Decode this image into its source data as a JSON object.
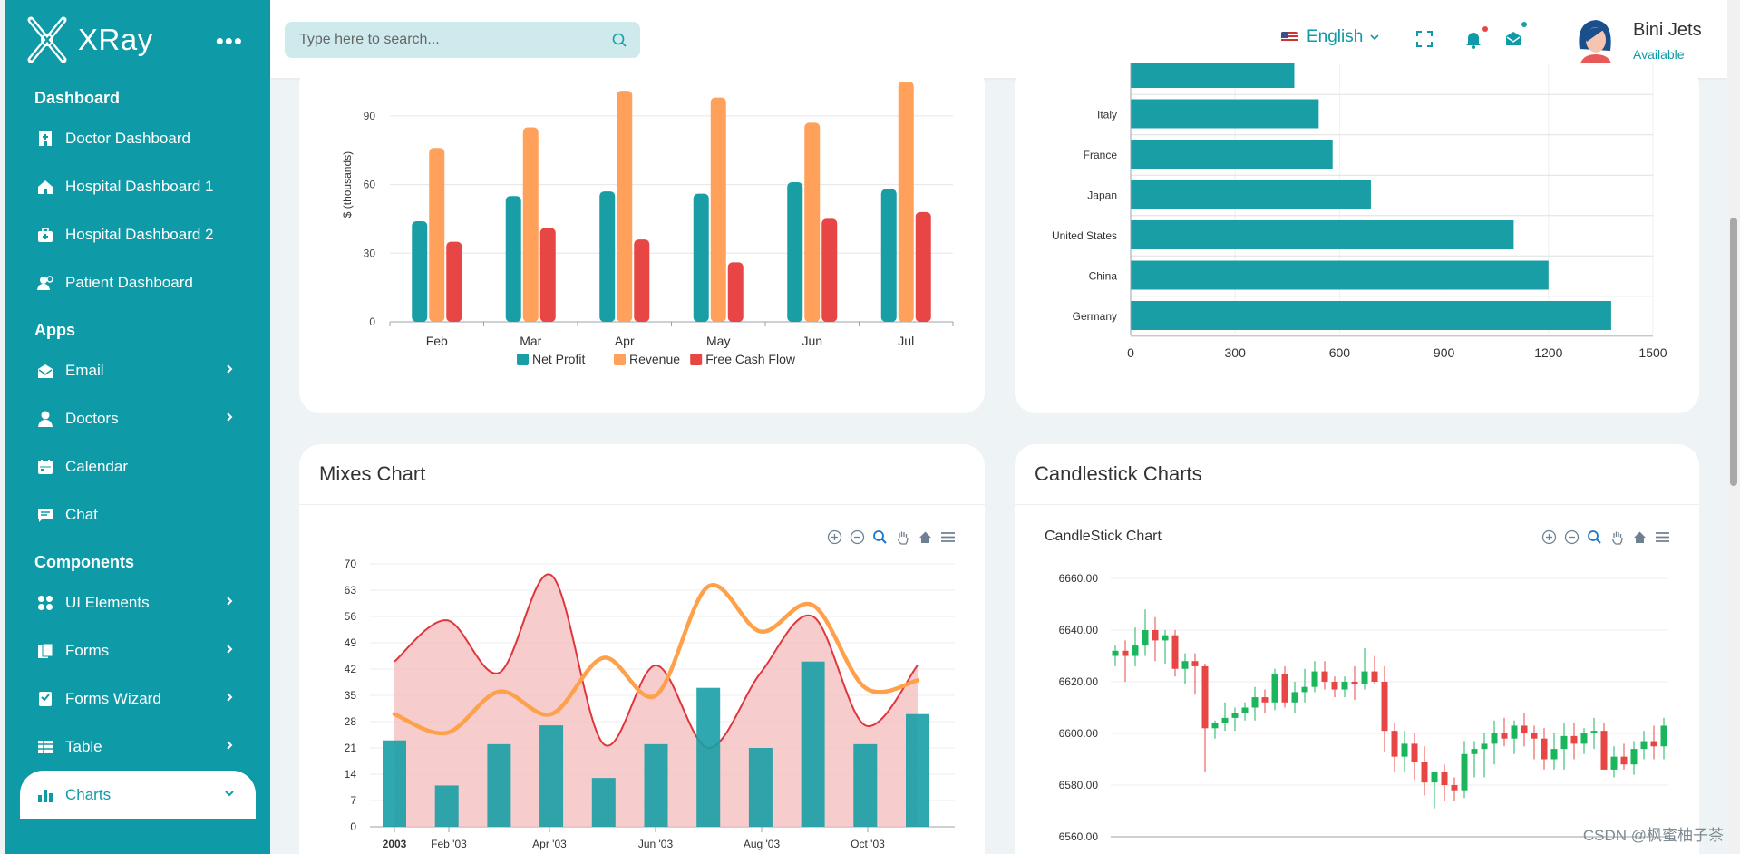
{
  "app": {
    "name": "XRay"
  },
  "search": {
    "placeholder": "Type here to search..."
  },
  "header": {
    "language": "English",
    "user_name": "Bini Jets",
    "user_status": "Available"
  },
  "sidebar": {
    "sections": [
      {
        "title": "Dashboard",
        "items": [
          {
            "label": "Doctor Dashboard",
            "icon": "hospital-building-icon"
          },
          {
            "label": "Hospital Dashboard 1",
            "icon": "home-icon"
          },
          {
            "label": "Hospital Dashboard 2",
            "icon": "medical-kit-icon"
          },
          {
            "label": "Patient Dashboard",
            "icon": "users-icon"
          }
        ]
      },
      {
        "title": "Apps",
        "items": [
          {
            "label": "Email",
            "icon": "email-icon",
            "expandable": true
          },
          {
            "label": "Doctors",
            "icon": "user-icon",
            "expandable": true
          },
          {
            "label": "Calendar",
            "icon": "calendar-icon"
          },
          {
            "label": "Chat",
            "icon": "chat-icon"
          }
        ]
      },
      {
        "title": "Components",
        "items": [
          {
            "label": "UI Elements",
            "icon": "grid-icon",
            "expandable": true
          },
          {
            "label": "Forms",
            "icon": "forms-icon",
            "expandable": true
          },
          {
            "label": "Forms Wizard",
            "icon": "wizard-icon",
            "expandable": true
          },
          {
            "label": "Table",
            "icon": "table-icon",
            "expandable": true
          },
          {
            "label": "Charts",
            "icon": "bar-chart-icon",
            "expandable": true,
            "active": true
          }
        ]
      }
    ]
  },
  "cards": {
    "mixed_title": "Mixes Chart",
    "candle_title": "Candlestick Charts",
    "candle_subtitle": "CandleStick Chart"
  },
  "watermark": "CSDN @枫蜜柚子茶",
  "colors": {
    "teal": "#1a9ea6",
    "orange": "#ffa15a",
    "red": "#e84545",
    "green": "#1bb55c",
    "area": "#f5c3c3",
    "sidebar": "#0e9aa7"
  },
  "chart_data": [
    {
      "type": "bar",
      "ylabel": "$ (thousands)",
      "categories": [
        "Feb",
        "Mar",
        "Apr",
        "May",
        "Jun",
        "Jul"
      ],
      "yticks": [
        0,
        30,
        60,
        90
      ],
      "ylim": [
        0,
        105
      ],
      "series": [
        {
          "name": "Net Profit",
          "values": [
            44,
            55,
            57,
            56,
            61,
            58
          ]
        },
        {
          "name": "Revenue",
          "values": [
            76,
            85,
            101,
            98,
            87,
            105
          ]
        },
        {
          "name": "Free Cash Flow",
          "values": [
            35,
            41,
            36,
            26,
            45,
            48
          ]
        }
      ],
      "legend": "bottom"
    },
    {
      "type": "bar",
      "orientation": "horizontal",
      "categories": [
        "",
        "Italy",
        "France",
        "Japan",
        "United States",
        "China",
        "Germany"
      ],
      "values": [
        470,
        540,
        580,
        690,
        1100,
        1200,
        1380
      ],
      "xticks": [
        0,
        300,
        600,
        900,
        1200,
        1500
      ],
      "xlim": [
        0,
        1500
      ]
    },
    {
      "type": "mixed",
      "yticks": [
        0,
        7,
        14,
        21,
        28,
        35,
        42,
        49,
        56,
        63,
        70
      ],
      "ylim": [
        0,
        70
      ],
      "xlabels": [
        "2003",
        "Feb '03",
        "Apr '03",
        "Jun '03",
        "Aug '03",
        "Oct '03"
      ],
      "columns": [
        23,
        11,
        22,
        27,
        13,
        22,
        37,
        21,
        44,
        22,
        30
      ],
      "area": [
        44,
        55,
        41,
        67,
        22,
        43,
        21,
        41,
        56,
        27,
        43
      ],
      "line": [
        30,
        25,
        36,
        30,
        45,
        35,
        64,
        52,
        59,
        37,
        39
      ]
    },
    {
      "type": "candlestick",
      "title": "CandleStick Chart",
      "yticks": [
        "6560.00",
        "6580.00",
        "6600.00",
        "6620.00",
        "6640.00",
        "6660.00"
      ],
      "ylim": [
        6560,
        6660
      ],
      "candles": [
        [
          6630,
          6634,
          6626,
          6632
        ],
        [
          6632,
          6636,
          6620,
          6630
        ],
        [
          6630,
          6641,
          6626,
          6634
        ],
        [
          6634,
          6648,
          6630,
          6640
        ],
        [
          6640,
          6645,
          6628,
          6636
        ],
        [
          6636,
          6640,
          6627,
          6638
        ],
        [
          6638,
          6640,
          6622,
          6625
        ],
        [
          6625,
          6631,
          6619,
          6628
        ],
        [
          6628,
          6631,
          6615,
          6626
        ],
        [
          6626,
          6627,
          6585,
          6602
        ],
        [
          6602,
          6605,
          6598,
          6604
        ],
        [
          6604,
          6612,
          6601,
          6606
        ],
        [
          6606,
          6610,
          6601,
          6608
        ],
        [
          6608,
          6612,
          6605,
          6610
        ],
        [
          6610,
          6618,
          6605,
          6614
        ],
        [
          6614,
          6617,
          6608,
          6612
        ],
        [
          6612,
          6625,
          6609,
          6623
        ],
        [
          6623,
          6626,
          6610,
          6612
        ],
        [
          6612,
          6620,
          6608,
          6616
        ],
        [
          6616,
          6625,
          6612,
          6618
        ],
        [
          6618,
          6628,
          6616,
          6624
        ],
        [
          6624,
          6628,
          6617,
          6620
        ],
        [
          6620,
          6622,
          6614,
          6617
        ],
        [
          6617,
          6622,
          6614,
          6620
        ],
        [
          6620,
          6626,
          6613,
          6619
        ],
        [
          6619,
          6633,
          6617,
          6624
        ],
        [
          6624,
          6630,
          6619,
          6620
        ],
        [
          6620,
          6626,
          6593,
          6601
        ],
        [
          6601,
          6604,
          6585,
          6591
        ],
        [
          6591,
          6601,
          6585,
          6596
        ],
        [
          6596,
          6600,
          6582,
          6589
        ],
        [
          6589,
          6595,
          6576,
          6581
        ],
        [
          6581,
          6585,
          6571,
          6585
        ],
        [
          6585,
          6588,
          6574,
          6580
        ],
        [
          6580,
          6583,
          6574,
          6578
        ],
        [
          6578,
          6597,
          6575,
          6592
        ],
        [
          6592,
          6597,
          6583,
          6594
        ],
        [
          6594,
          6600,
          6583,
          6596
        ],
        [
          6596,
          6605,
          6588,
          6600
        ],
        [
          6600,
          6606,
          6595,
          6598
        ],
        [
          6598,
          6605,
          6592,
          6603
        ],
        [
          6603,
          6608,
          6595,
          6600
        ],
        [
          6600,
          6603,
          6590,
          6598
        ],
        [
          6598,
          6602,
          6586,
          6590
        ],
        [
          6590,
          6600,
          6586,
          6594
        ],
        [
          6594,
          6604,
          6586,
          6599
        ],
        [
          6599,
          6604,
          6590,
          6596
        ],
        [
          6596,
          6602,
          6592,
          6600
        ],
        [
          6600,
          6606,
          6594,
          6601
        ],
        [
          6601,
          6604,
          6587,
          6586
        ],
        [
          6586,
          6595,
          6583,
          6591
        ],
        [
          6591,
          6596,
          6586,
          6588
        ],
        [
          6588,
          6597,
          6584,
          6594
        ],
        [
          6594,
          6601,
          6590,
          6597
        ],
        [
          6597,
          6603,
          6590,
          6595
        ],
        [
          6595,
          6606,
          6590,
          6603
        ]
      ]
    }
  ]
}
